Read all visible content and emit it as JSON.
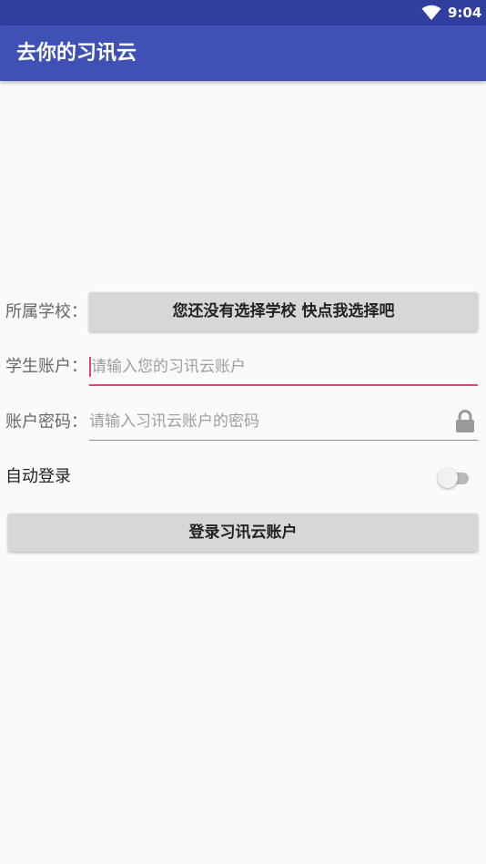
{
  "status_bar": {
    "time": "9:04",
    "wifi_icon": "wifi-icon"
  },
  "app_bar": {
    "title": "去你的习讯云"
  },
  "form": {
    "school": {
      "label": "所属学校：",
      "button_label": "您还没有选择学校 快点我选择吧"
    },
    "account": {
      "label": "学生账户：",
      "value": "",
      "placeholder": "请输入您的习讯云账户"
    },
    "password": {
      "label": "账户密码：",
      "value": "",
      "placeholder": "请输入习讯云账户的密码",
      "icon": "lock-icon"
    },
    "auto_login": {
      "label": "自动登录",
      "enabled": false
    },
    "login_button_label": "登录习讯云账户"
  },
  "colors": {
    "status_bar": "#303f9f",
    "app_bar": "#3f51b5",
    "focus_accent": "#ec407a",
    "button_bg": "#d6d7d7"
  }
}
